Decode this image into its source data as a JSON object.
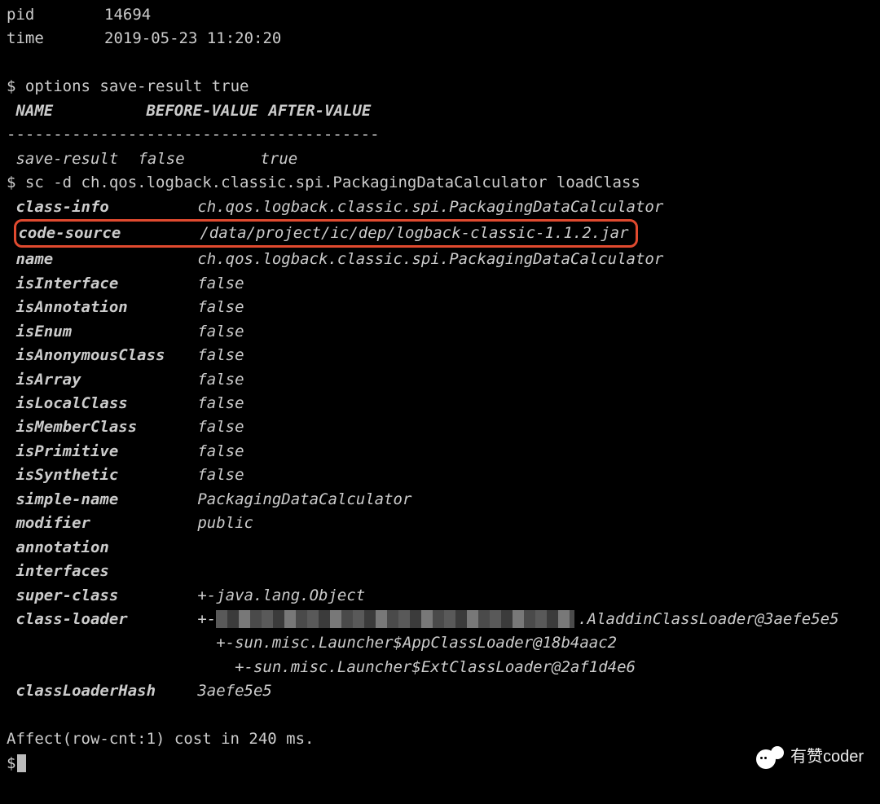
{
  "header": {
    "pid_label": "pid",
    "pid_value": "14694",
    "time_label": "time",
    "time_value": "2019-05-23 11:20:20"
  },
  "options_cmd": {
    "prompt": "$",
    "command": "options save-result true",
    "cols": {
      "name": "NAME",
      "before": "BEFORE-VALUE",
      "after": "AFTER-VALUE"
    },
    "sep": "----------------------------------------",
    "row": {
      "name": "save-result",
      "before": "false",
      "after": "true"
    }
  },
  "sc_cmd": {
    "prompt": "$",
    "command": "sc -d ch.qos.logback.classic.spi.PackagingDataCalculator loadClass"
  },
  "details": {
    "class_info": {
      "k": "class-info",
      "v": "ch.qos.logback.classic.spi.PackagingDataCalculator"
    },
    "code_source": {
      "k": "code-source",
      "v": "/data/project/ic/dep/logback-classic-1.1.2.jar"
    },
    "name": {
      "k": "name",
      "v": "ch.qos.logback.classic.spi.PackagingDataCalculator"
    },
    "isInterface": {
      "k": "isInterface",
      "v": "false"
    },
    "isAnnotation": {
      "k": "isAnnotation",
      "v": "false"
    },
    "isEnum": {
      "k": "isEnum",
      "v": "false"
    },
    "isAnonymousClass": {
      "k": "isAnonymousClass",
      "v": "false"
    },
    "isArray": {
      "k": "isArray",
      "v": "false"
    },
    "isLocalClass": {
      "k": "isLocalClass",
      "v": "false"
    },
    "isMemberClass": {
      "k": "isMemberClass",
      "v": "false"
    },
    "isPrimitive": {
      "k": "isPrimitive",
      "v": "false"
    },
    "isSynthetic": {
      "k": "isSynthetic",
      "v": "false"
    },
    "simple_name": {
      "k": "simple-name",
      "v": "PackagingDataCalculator"
    },
    "modifier": {
      "k": "modifier",
      "v": "public"
    },
    "annotation": {
      "k": "annotation",
      "v": ""
    },
    "interfaces": {
      "k": "interfaces",
      "v": ""
    },
    "super_class": {
      "k": "super-class",
      "v": "+-java.lang.Object"
    },
    "class_loader": {
      "k": "class-loader",
      "v0_prefix": "+-",
      "v0_suffix": ".AladdinClassLoader@3aefe5e5",
      "v1": "+-sun.misc.Launcher$AppClassLoader@18b4aac2",
      "v2": "+-sun.misc.Launcher$ExtClassLoader@2af1d4e6"
    },
    "classLoaderHash": {
      "k": "classLoaderHash",
      "v": "3aefe5e5"
    }
  },
  "footer": {
    "affect": "Affect(row-cnt:1) cost in 240 ms.",
    "prompt": "$"
  },
  "watermark": {
    "text": "有赞coder"
  }
}
